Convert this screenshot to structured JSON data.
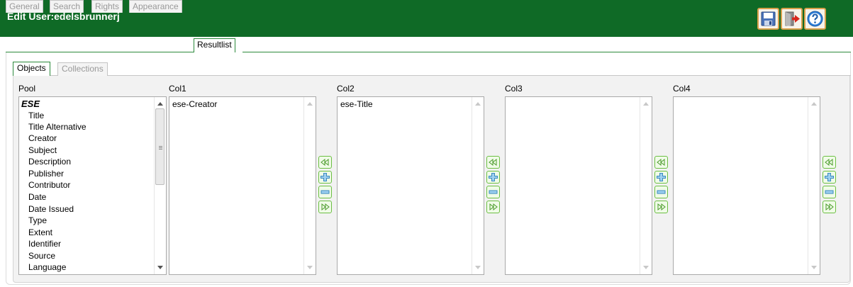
{
  "window": {
    "title": "Edit User:edelsbrunnerj"
  },
  "toolbar": {
    "save_icon": "save-icon",
    "exit_icon": "exit-icon",
    "help_icon": "help-icon",
    "accent": "#0f6a26",
    "button_border": "#d8a04a"
  },
  "tabs": [
    {
      "label": "General"
    },
    {
      "label": "Search"
    },
    {
      "label": "Rights"
    },
    {
      "label": "Appearance"
    },
    {
      "label": "Resultlist"
    }
  ],
  "subtabs": [
    {
      "label": "Objects"
    },
    {
      "label": "Collections"
    }
  ],
  "pool": {
    "header": "Pool",
    "group": "ESE",
    "items": [
      {
        "label": "Title"
      },
      {
        "label": "Title Alternative"
      },
      {
        "label": "Creator"
      },
      {
        "label": "Subject"
      },
      {
        "label": "Description"
      },
      {
        "label": "Publisher"
      },
      {
        "label": "Contributor"
      },
      {
        "label": "Date"
      },
      {
        "label": "Date Issued"
      },
      {
        "label": "Type"
      },
      {
        "label": "Extent"
      },
      {
        "label": "Identifier"
      },
      {
        "label": "Source"
      },
      {
        "label": "Language"
      }
    ]
  },
  "columns": [
    {
      "header": "Col1",
      "items": [
        "ese-Creator"
      ]
    },
    {
      "header": "Col2",
      "items": [
        "ese-Title"
      ]
    },
    {
      "header": "Col3",
      "items": []
    },
    {
      "header": "Col4",
      "items": []
    }
  ],
  "actions": [
    "move-left-icon",
    "add-icon",
    "remove-icon",
    "move-right-icon"
  ]
}
